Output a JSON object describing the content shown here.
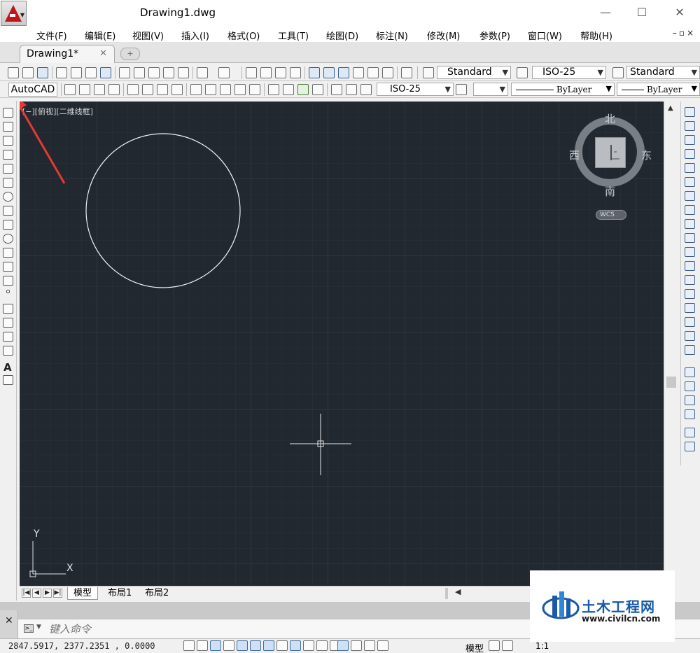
{
  "window": {
    "title": "Drawing1.dwg",
    "controls": {
      "minimize": "—",
      "maximize": "☐",
      "close": "✕"
    }
  },
  "menu": {
    "items": [
      "文件(F)",
      "编辑(E)",
      "视图(V)",
      "插入(I)",
      "格式(O)",
      "工具(T)",
      "绘图(D)",
      "标注(N)",
      "修改(M)",
      "参数(P)",
      "窗口(W)",
      "帮助(H)"
    ],
    "mdi_controls": "–▫×"
  },
  "tabs": {
    "active": "Drawing1*",
    "close": "✕",
    "new": "+"
  },
  "toolbar1": {
    "text_style": "Standard",
    "dim_style": "ISO-25",
    "table_style": "Standard"
  },
  "toolbar2": {
    "workspace": "AutoCAD",
    "dim_style": "ISO-25",
    "linetype": "ByLayer",
    "lineweight": "ByLayer"
  },
  "viewport": {
    "label": "[−][俯视][二维线框]",
    "ucs_y": "Y",
    "ucs_x": "X"
  },
  "viewcube": {
    "north": "北",
    "south": "南",
    "east": "东",
    "west": "西",
    "coord_system": "WCS"
  },
  "layout_tabs": {
    "model": "模型",
    "layout1": "布局1",
    "layout2": "布局2"
  },
  "command": {
    "placeholder": "键入命令",
    "close": "✕"
  },
  "status": {
    "coords": "2847.5917,  2377.2351 ,  0.0000",
    "model": "模型",
    "annotation_scale": "1:1"
  },
  "watermark": {
    "name": "土木工程网",
    "url": "www.civilcn.com"
  },
  "colors": {
    "canvas": "#212830",
    "arrow": "#e53935",
    "brand": "#c0161b",
    "watermark_blue": "#1a5aa6"
  }
}
